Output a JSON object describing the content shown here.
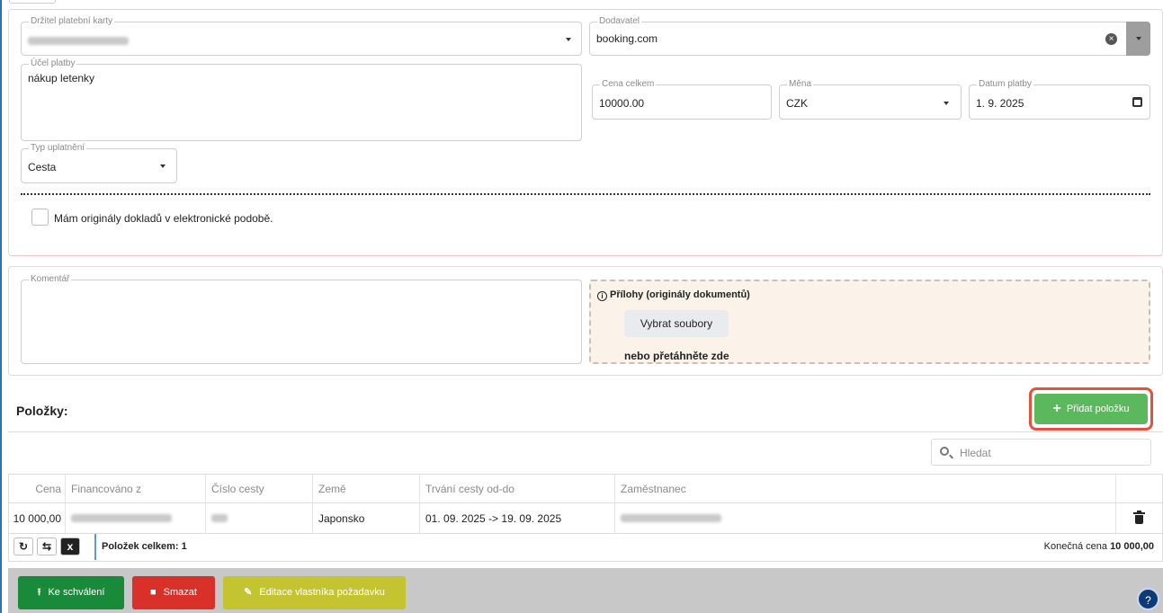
{
  "form": {
    "card_holder": {
      "label": "Držitel platební karty",
      "value": "Rostul Tomáš (0180)"
    },
    "supplier": {
      "label": "Dodavatel",
      "value": "booking.com"
    },
    "purpose": {
      "label": "Účel platby",
      "value": "nákup letenky"
    },
    "total_price": {
      "label": "Cena celkem",
      "value": "10000.00"
    },
    "currency": {
      "label": "Měna",
      "value": "CZK"
    },
    "payment_date": {
      "label": "Datum platby",
      "value": "1. 9. 2025"
    },
    "claim_type": {
      "label": "Typ uplatnění",
      "value": "Cesta"
    },
    "originals_checkbox_label": "Mám originály dokladů v elektronické podobě.",
    "originals_checked": false
  },
  "comment": {
    "label": "Komentář",
    "value": ""
  },
  "attachments": {
    "title": "Přílohy (originály dokumentů)",
    "select_button": "Vybrat soubory",
    "drop_text": "nebo přetáhněte zde"
  },
  "items": {
    "title": "Položky:",
    "add_button": "Přidat položku",
    "search_placeholder": "Hledat",
    "columns": [
      "Cena",
      "Financováno z",
      "Číslo cesty",
      "Země",
      "Trvání cesty od-do",
      "Zaměstnanec"
    ],
    "rows": [
      {
        "price": "10 000,00",
        "financed_from": "1610 HC (01) sciebnc",
        "trip_number": "006",
        "country": "Japonsko",
        "duration": "01. 09. 2025 -> 19. 09. 2025",
        "employee": "Rostul Tomáš (0180)"
      }
    ],
    "count_label": "Položek celkem: 1",
    "total_label": "Konečná cena",
    "total_value": "10 000,00"
  },
  "actions": {
    "approve": "Ke schválení",
    "delete": "Smazat",
    "edit_owner": "Editace vlastníka požadavku"
  },
  "icons": [
    "info-icon",
    "plus-icon",
    "search-icon",
    "trash-icon",
    "refresh-icon",
    "fit-columns-icon",
    "excel-export-icon",
    "upload-icon",
    "pencil-icon",
    "help-icon",
    "calendar-icon",
    "clear-icon"
  ],
  "colors": {
    "add_button": "#5cb85c",
    "highlight_outline": "#e0533d",
    "approve": "#198a3a",
    "delete": "#d9302a",
    "edit_owner": "#c4c431",
    "attachment_bg": "#fbf3e9"
  }
}
